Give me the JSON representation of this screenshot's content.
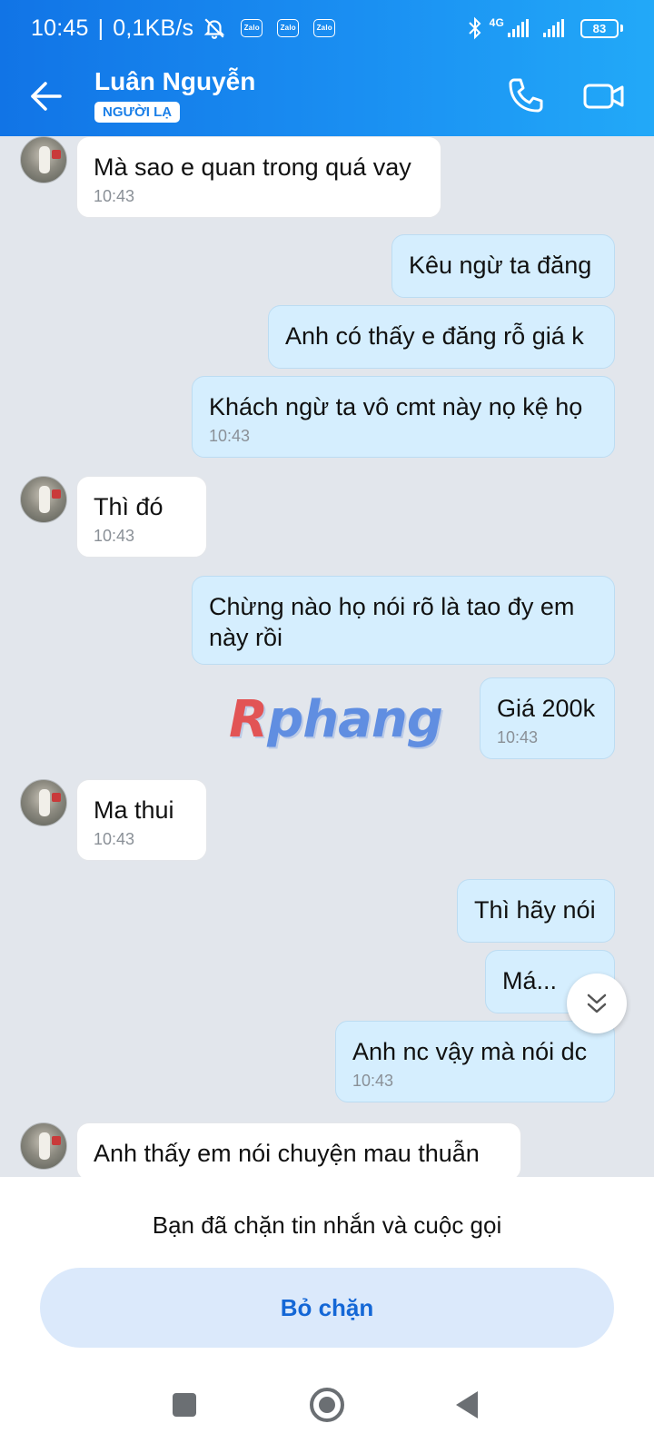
{
  "status": {
    "time": "10:45",
    "speed": "0,1KB/s",
    "app_icons": [
      "Zalo",
      "Zalo",
      "Zalo"
    ],
    "network": "4G",
    "battery": "83"
  },
  "header": {
    "contact_name": "Luân Nguyễn",
    "badge": "NGƯỜI LẠ",
    "icons": [
      "back-arrow-icon",
      "phone-icon",
      "video-call-icon"
    ]
  },
  "messages": [
    {
      "text": "Mà sao e quan trong quá vay",
      "time": "10:43"
    },
    {
      "text": "Kêu ngừ ta đăng"
    },
    {
      "text": "Anh có thấy e đăng rỗ giá k"
    },
    {
      "text": "Khách ngừ ta vô cmt này nọ kệ họ",
      "time": "10:43"
    },
    {
      "text": "Thì đó",
      "time": "10:43"
    },
    {
      "text": "Chừng nào họ nói rõ là tao đy em này rồi"
    },
    {
      "text": "Giá 200k",
      "time": "10:43"
    },
    {
      "text": "Ma thui",
      "time": "10:43"
    },
    {
      "text": "Thì hãy nói"
    },
    {
      "text": "Má..."
    },
    {
      "text": "Anh nc vậy mà nói dc",
      "time": "10:43"
    },
    {
      "text": "Anh thấy em nói chuyện mau thuẫn"
    }
  ],
  "watermark": {
    "first": "R",
    "rest": "phang"
  },
  "footer": {
    "blocked_notice": "Bạn đã chặn tin nhắn và cuộc gọi",
    "unblock_label": "Bỏ chặn"
  },
  "colors": {
    "header_start": "#1174e6",
    "header_end": "#22a9f8",
    "outgoing_bubble": "#d5eefe",
    "incoming_bubble": "#ffffff",
    "chat_bg": "#e2e6ec",
    "unblock_text": "#1467d6"
  }
}
